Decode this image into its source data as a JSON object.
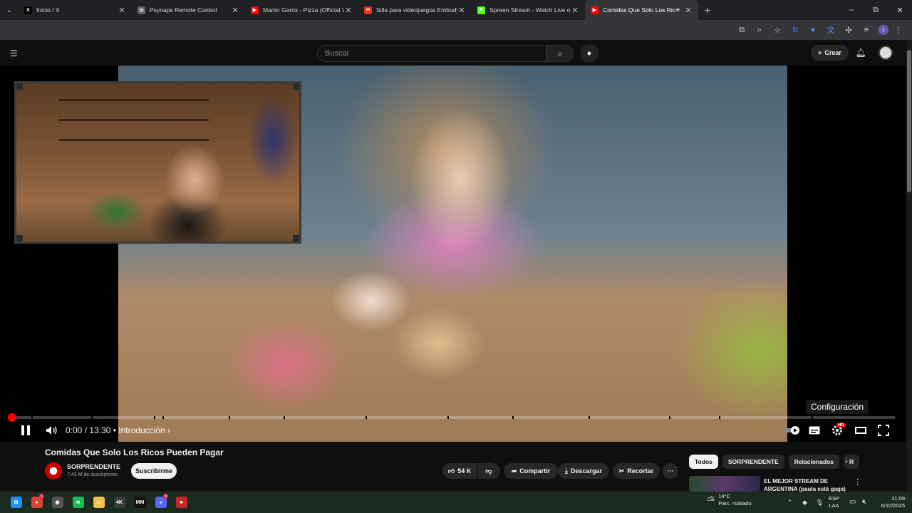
{
  "browser": {
    "tabs": [
      {
        "title": "Inicio / X",
        "favicon": "x-logo-icon",
        "color": "#000000",
        "glyph": "X",
        "active": false
      },
      {
        "title": "Psynaps Remote Control",
        "favicon": "globe-icon",
        "color": "#5f6368",
        "glyph": "◎",
        "active": false
      },
      {
        "title": "Martin Garrix - Pizza (Official Vi",
        "favicon": "youtube-icon",
        "color": "#ff0000",
        "glyph": "▶",
        "active": false
      },
      {
        "title": "Silla para videojuegos Embody",
        "favicon": "store-icon",
        "color": "#e8291c",
        "glyph": "H",
        "active": false
      },
      {
        "title": "Spreen Stream - Watch Live on",
        "favicon": "kick-icon",
        "color": "#53fc18",
        "glyph": "K",
        "active": false
      },
      {
        "title": "Comidas Que Solo Los Rico",
        "favicon": "youtube-icon",
        "color": "#ff0000",
        "glyph": "▶",
        "active": true,
        "audio": true
      }
    ],
    "new_tab": "+",
    "window_controls": {
      "minimize": "–",
      "restore": "⧉",
      "close": "✕"
    }
  },
  "youtube": {
    "search_placeholder": "Buscar",
    "create_label": "Crear"
  },
  "player": {
    "current_time": "0:00",
    "duration": "13:30",
    "separator": " / ",
    "chapter": "• Introducción ›",
    "progress_fraction": 0.0,
    "tooltip": "Configuración",
    "hd_badge": "HD",
    "accent": "#ff0000"
  },
  "video": {
    "title": "Comidas Que Solo Los Ricos Pueden Pagar",
    "channel": "SORPRENDENTE",
    "subscribers": "7,43 M de suscriptores",
    "subscribe_label": "Suscribirme",
    "likes": "54 K",
    "share_label": "Compartir",
    "download_label": "Descargar",
    "clip_label": "Recortar",
    "more_label": "···"
  },
  "sidebar": {
    "chips": [
      "Todos",
      "SORPRENDENTE",
      "Relacionados",
      "R"
    ],
    "recommendation_title": "EL MEJOR STREAM DE ARGENTINA (paula está gaga)"
  },
  "taskbar": {
    "weather_temp": "14°C",
    "weather_desc": "Parc. nublado",
    "lang_top": "ESP",
    "lang_bottom": "LAA",
    "time": "21:09",
    "date": "6/10/2025",
    "apps": [
      {
        "name": "windows-start-icon",
        "color": "#1e90ff",
        "glyph": "⊞"
      },
      {
        "name": "chrome-icon",
        "color": "#db4437",
        "glyph": "●",
        "badge": "1"
      },
      {
        "name": "chrome-alt-icon",
        "color": "#555555",
        "glyph": "◉"
      },
      {
        "name": "spotify-icon",
        "color": "#1db954",
        "glyph": "≋"
      },
      {
        "name": "file-explorer-icon",
        "color": "#f2c14e",
        "glyph": "▭"
      },
      {
        "name": "app-4k-icon",
        "color": "#3a3a3a",
        "glyph": "4K"
      },
      {
        "name": "app-mm-icon",
        "color": "#111111",
        "glyph": "MM"
      },
      {
        "name": "discord-icon",
        "color": "#5865f2",
        "glyph": "◕",
        "badge": "9"
      },
      {
        "name": "app-red-icon",
        "color": "#c62828",
        "glyph": "■"
      }
    ]
  }
}
